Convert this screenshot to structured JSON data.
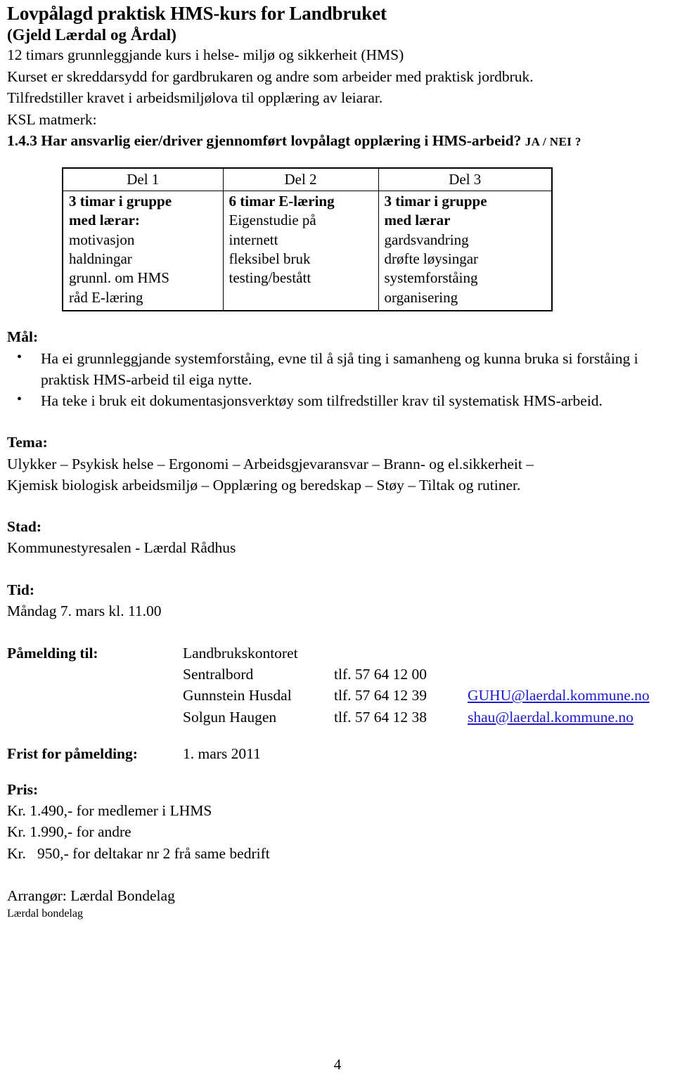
{
  "document": {
    "title": "Lovpålagd praktisk HMS-kurs for Landbruket",
    "subtitle": "(Gjeld Lærdal og Årdal)",
    "intro_line_1": "12 timars grunnleggjande  kurs i helse- miljø og sikkerheit (HMS)",
    "intro_line_2": "Kurset er skreddarsydd for gardbrukaren og andre som arbeider med praktisk jordbruk.",
    "intro_line_3": "Tilfredstiller kravet i arbeidsmiljølova til opplæring av leiarar.",
    "ksl_label": "KSL matmerk:",
    "ksl_question": "1.4.3 Har ansvarlig eier/driver gjennomført lovpålagt opplæring i HMS-arbeid?",
    "ksl_answer_options": "JA / NEI ?",
    "page_number": "4"
  },
  "parts_table": {
    "headers": [
      "Del 1",
      "Del 2",
      "Del 3"
    ],
    "columns": [
      {
        "lines": [
          {
            "text": "3 timar i gruppe",
            "bold": true
          },
          {
            "text": "med lærar:",
            "bold": true
          },
          {
            "text": "motivasjon",
            "bold": false
          },
          {
            "text": "haldningar",
            "bold": false
          },
          {
            "text": "grunnl. om HMS",
            "bold": false
          },
          {
            "text": "råd E-læring",
            "bold": false
          }
        ]
      },
      {
        "lines": [
          {
            "text": "6 timar E-læring",
            "bold": true
          },
          {
            "text": "Eigenstudie på",
            "bold": false
          },
          {
            "text": "internett",
            "bold": false
          },
          {
            "text": "fleksibel bruk",
            "bold": false
          },
          {
            "text": "testing/bestått",
            "bold": false
          }
        ]
      },
      {
        "lines": [
          {
            "text": "3 timar i gruppe",
            "bold": true
          },
          {
            "text": "med lærar",
            "bold": true
          },
          {
            "text": "gardsvandring",
            "bold": false
          },
          {
            "text": "drøfte løysingar",
            "bold": false
          },
          {
            "text": "systemforståing",
            "bold": false
          },
          {
            "text": "organisering",
            "bold": false
          }
        ]
      }
    ]
  },
  "goals": {
    "heading": "Mål:",
    "items": [
      "Ha ei grunnleggjande systemforståing, evne til å sjå ting i samanheng og kunna bruka si forståing i praktisk HMS-arbeid til eiga nytte.",
      "Ha teke i bruk eit dokumentasjonsverktøy som tilfredstiller krav til systematisk HMS-arbeid."
    ]
  },
  "tema": {
    "heading": "Tema:",
    "line_1": "Ulykker – Psykisk helse – Ergonomi – Arbeidsgjevaransvar – Brann- og el.sikkerheit –",
    "line_2": "Kjemisk biologisk arbeidsmiljø – Opplæring og beredskap – Støy – Tiltak og rutiner."
  },
  "stad": {
    "heading": "Stad:",
    "value": "Kommunestyresalen -  Lærdal Rådhus"
  },
  "tid": {
    "heading": "Tid:",
    "value": "Måndag 7. mars kl. 11.00"
  },
  "registration": {
    "heading": "Påmelding til:",
    "office": "Landbrukskontoret",
    "rows": [
      {
        "name": "Sentralbord",
        "phone": "tlf. 57 64 12 00",
        "email": ""
      },
      {
        "name": "Gunnstein Husdal",
        "phone": "tlf. 57 64 12 39",
        "email": "GUHU@laerdal.kommune.no"
      },
      {
        "name": "Solgun Haugen",
        "phone": "tlf. 57 64 12 38",
        "email": "shau@laerdal.kommune.no"
      }
    ],
    "deadline_label": "Frist for påmelding:",
    "deadline_value": "1. mars 2011"
  },
  "price": {
    "heading": "Pris:",
    "lines": [
      "Kr. 1.490,- for medlemer i LHMS",
      "Kr. 1.990,- for andre",
      "Kr.   950,- for deltakar nr 2 frå same bedrift"
    ]
  },
  "footer": {
    "arranger": "Arrangør: Lærdal Bondelag",
    "organisation": "Lærdal bondelag"
  },
  "colors": {
    "text": "#000000",
    "link": "#1a1ad0",
    "background": "#ffffff",
    "table_border": "#000000"
  }
}
